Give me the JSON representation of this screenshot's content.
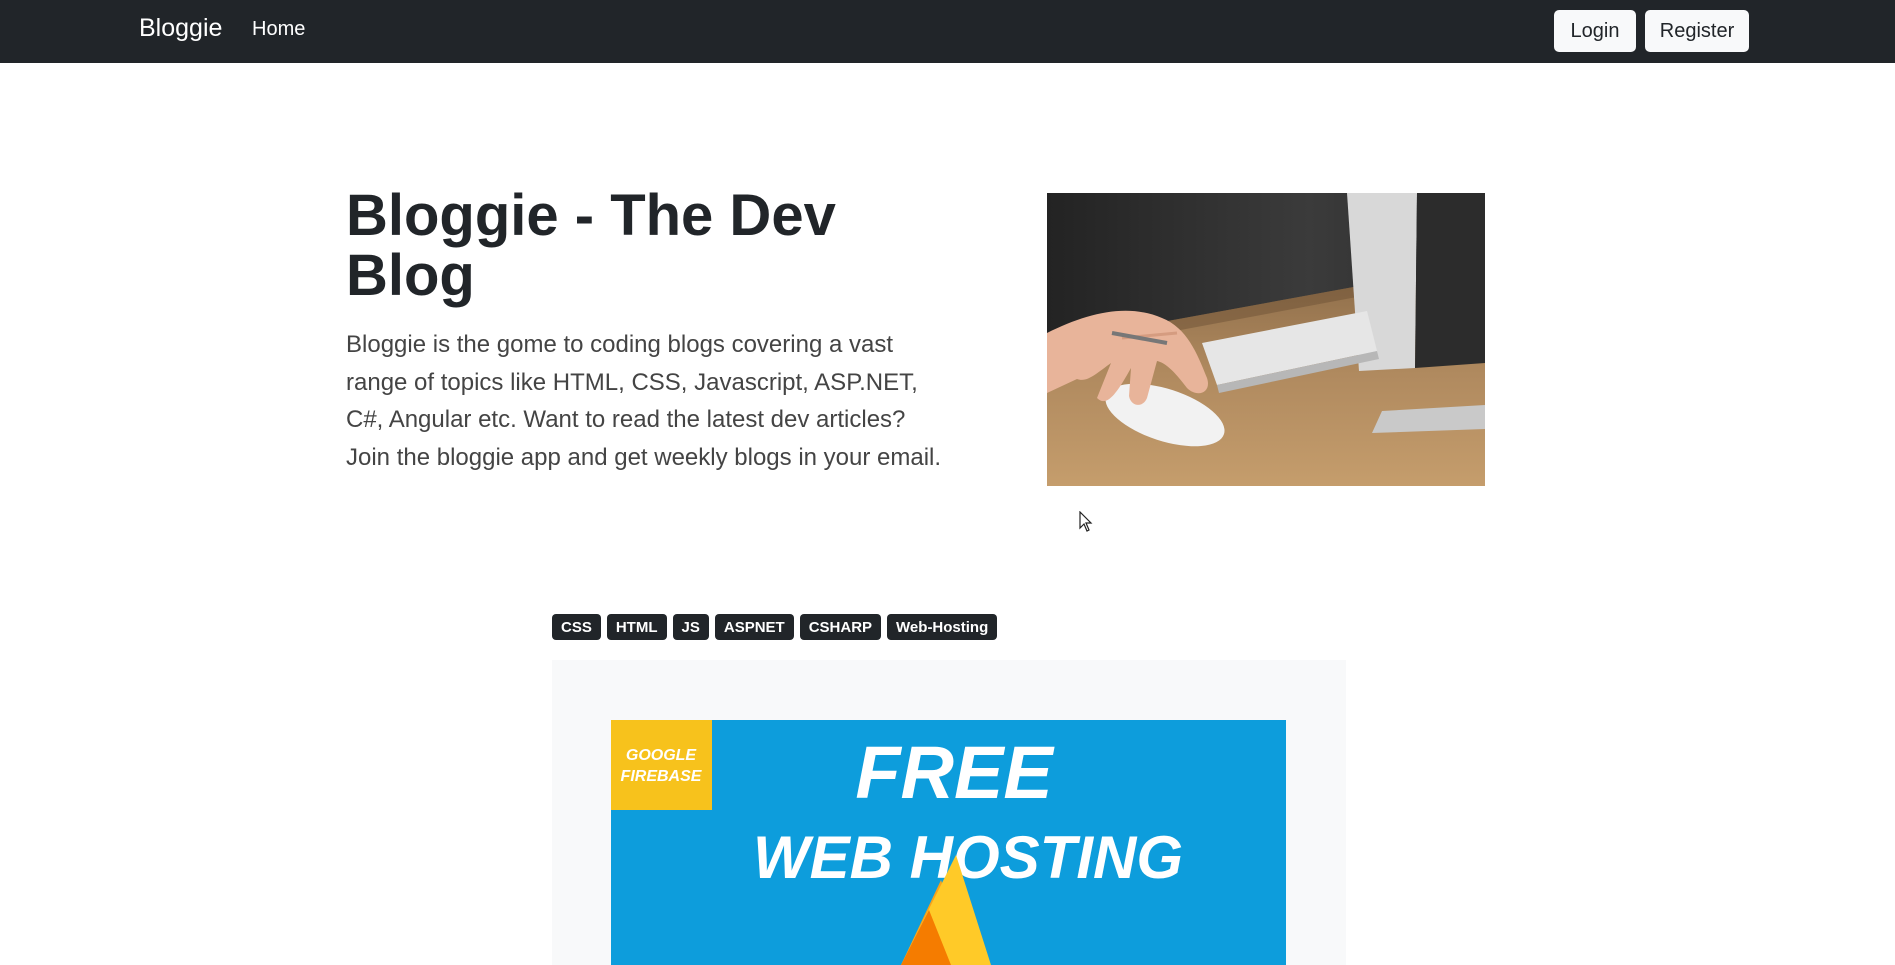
{
  "navbar": {
    "brand": "Bloggie",
    "home": "Home",
    "login": "Login",
    "register": "Register"
  },
  "hero": {
    "title": "Bloggie - The Dev Blog",
    "text": "Bloggie is the gome to coding blogs covering a vast range of topics like HTML, CSS, Javascript, ASP.NET, C#, Angular etc. Want to read the latest dev articles? Join the bloggie app and get weekly blogs in your email."
  },
  "tags": [
    "CSS",
    "HTML",
    "JS",
    "ASPNET",
    "CSHARP",
    "Web-Hosting"
  ],
  "banner": {
    "badge_line1": "GOOGLE",
    "badge_line2": "FIREBASE",
    "headline1": "FREE",
    "headline2": "WEB HOSTING"
  },
  "colors": {
    "navbar_bg": "#212529",
    "light_button": "#f8f9fa",
    "tag_bg": "#212529",
    "banner_blue": "#0d9ddc",
    "banner_yellow": "#f7c21c"
  },
  "icons": {
    "cursor": "mouse-pointer-icon",
    "firebase": "firebase-flame-icon"
  }
}
